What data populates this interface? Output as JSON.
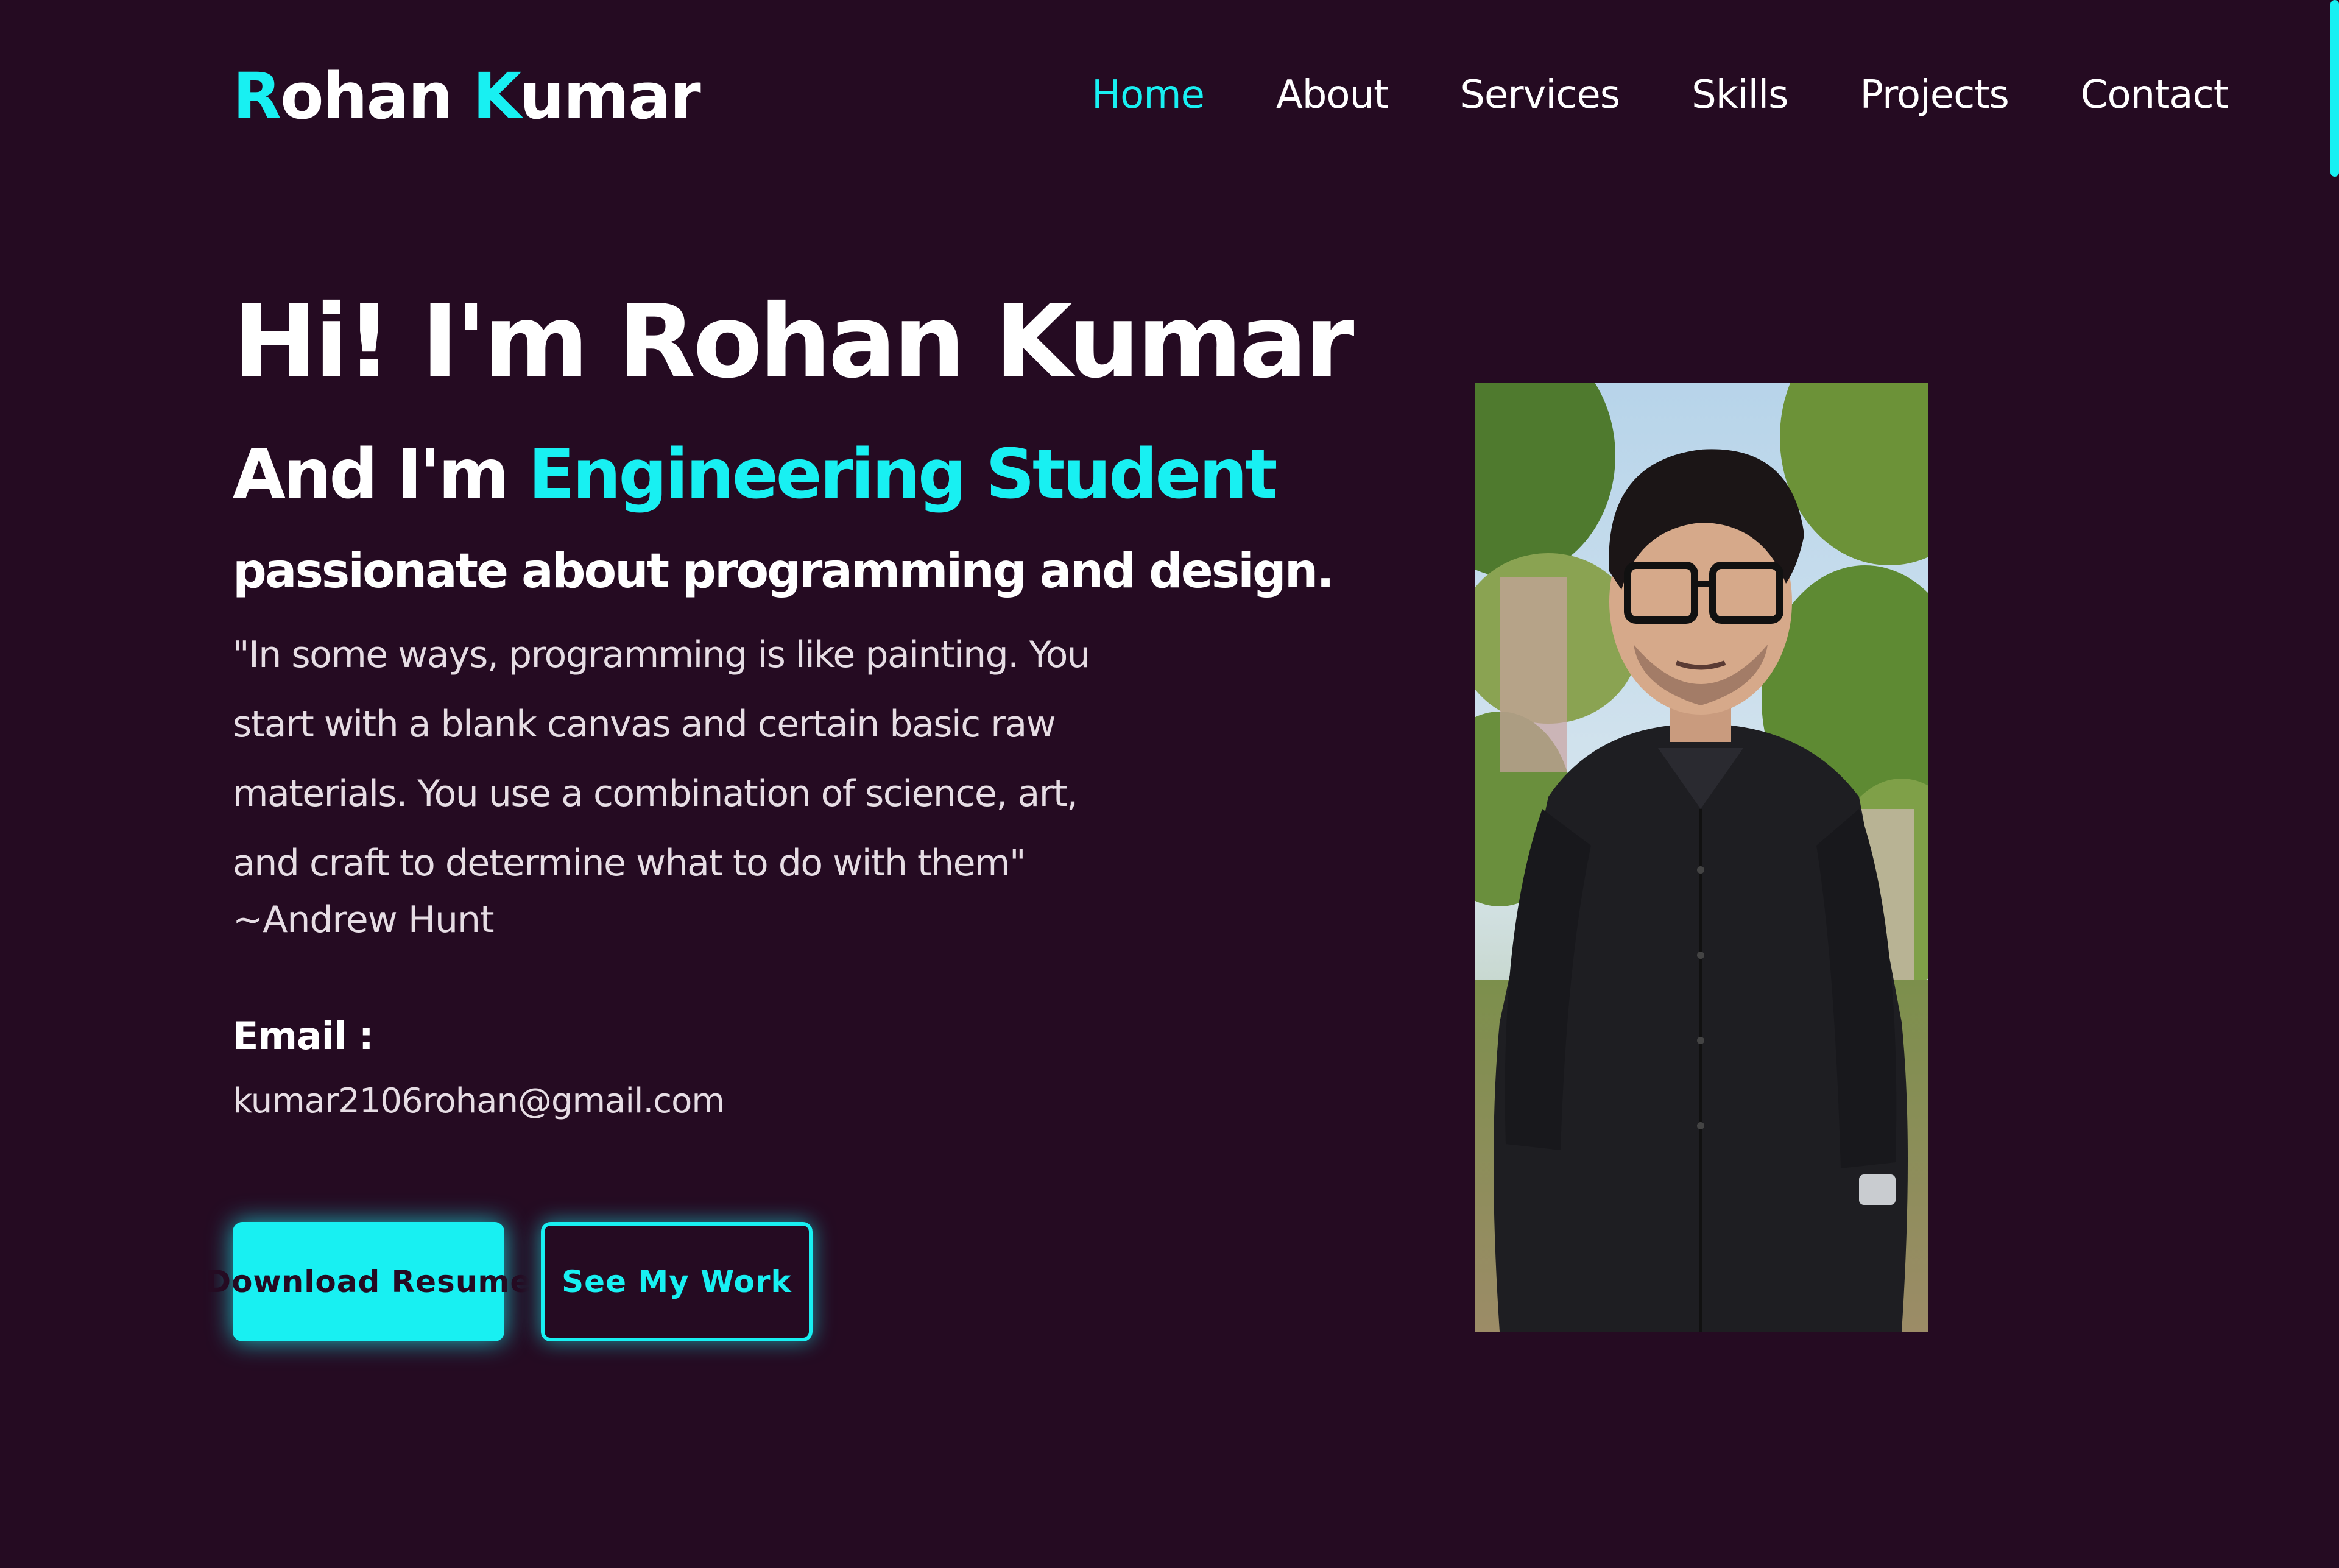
{
  "header": {
    "logo_first_initial": "R",
    "logo_first_rest": "ohan ",
    "logo_last_initial": "K",
    "logo_last_rest": "umar",
    "nav": [
      "Home",
      "About",
      "Services",
      "Skills",
      "Projects",
      "Contact"
    ],
    "active_nav": "Home"
  },
  "hero": {
    "title": "Hi! I'm Rohan Kumar",
    "role_prefix": "And I'm ",
    "role": "Engineering Student",
    "passion": "passionate about programming and design.",
    "quote": "\"In some ways, programming is like painting. You start with a blank canvas and certain basic raw materials. You use a combination of science, art, and craft to determine what to do with them\"",
    "quote_author": "~Andrew Hunt",
    "email_label": "Email :",
    "email": "kumar2106rohan@gmail.com",
    "buttons": {
      "primary": "Download Resume",
      "secondary": "See My Work"
    }
  },
  "colors": {
    "background": "#250b22",
    "accent": "#18f0f2",
    "text": "#ffffff"
  },
  "icons": {
    "profile_photo": "person-photo"
  }
}
